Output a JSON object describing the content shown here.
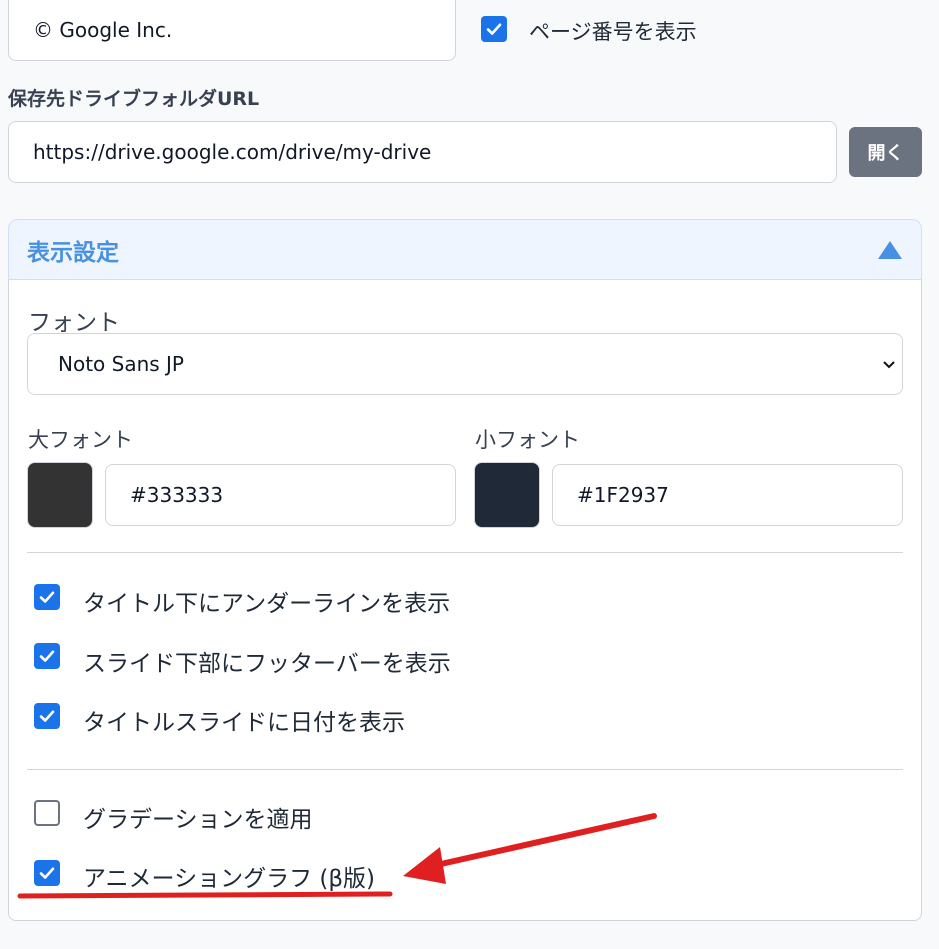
{
  "top": {
    "copyright_value": "© Google Inc.",
    "show_page_number_label": "ページ番号を表示",
    "show_page_number_checked": true
  },
  "drive": {
    "label": "保存先ドライブフォルダURL",
    "url_value": "https://drive.google.com/drive/my-drive",
    "open_button": "開く"
  },
  "display_settings": {
    "title": "表示設定",
    "collapse_icon": "triangle-up-icon",
    "font_label": "フォント",
    "font_selected": "Noto Sans JP",
    "large_font_label": "大フォント",
    "large_font_color": "#333333",
    "small_font_label": "小フォント",
    "small_font_color": "#1F2937",
    "options": [
      {
        "label": "タイトル下にアンダーラインを表示",
        "checked": true
      },
      {
        "label": "スライド下部にフッターバーを表示",
        "checked": true
      },
      {
        "label": "タイトルスライドに日付を表示",
        "checked": true
      }
    ],
    "extra_options": [
      {
        "label": "グラデーションを適用",
        "checked": false
      },
      {
        "label": "アニメーショングラフ (β版)",
        "checked": true
      }
    ]
  },
  "colors": {
    "accent": "#1a73e8",
    "header_text": "#4a90e2",
    "annotation_red": "#e02020"
  }
}
